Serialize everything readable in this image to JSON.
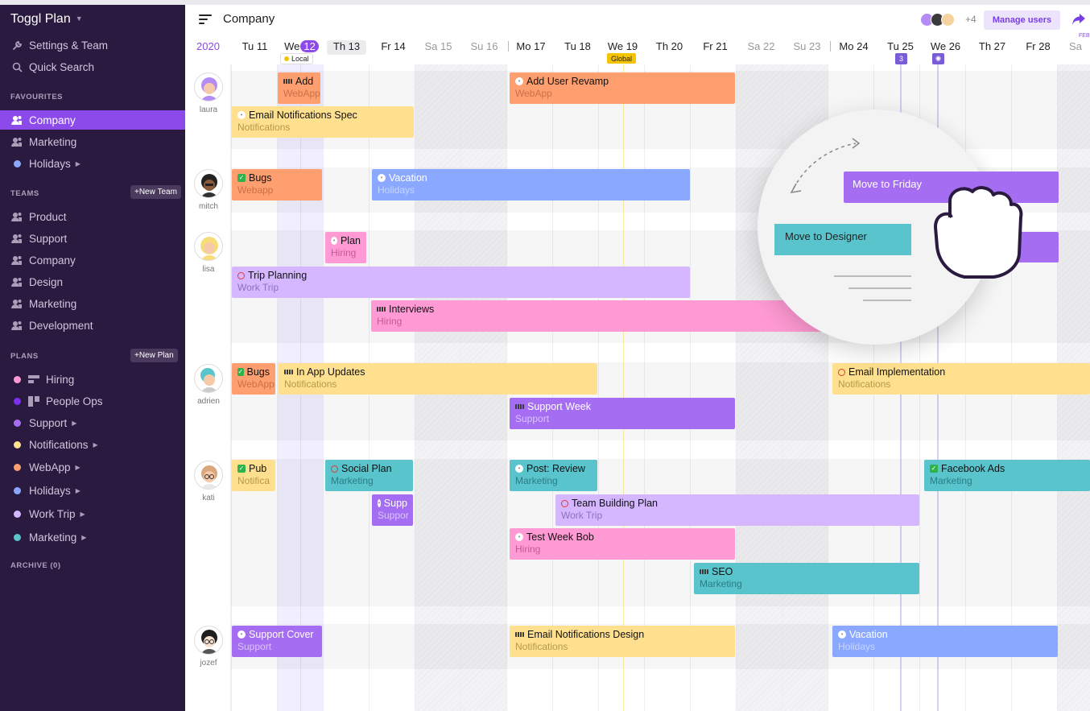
{
  "app": {
    "brand": "Toggl Plan",
    "settings_label": "Settings & Team",
    "search_label": "Quick Search"
  },
  "sidebar": {
    "favourites_title": "FAVOURITES",
    "favourites": [
      {
        "label": "Company",
        "active": true
      },
      {
        "label": "Marketing"
      },
      {
        "label": "Holidays",
        "dot": "#8aa8ff"
      }
    ],
    "teams_title": "TEAMS",
    "new_team_label": "+New Team",
    "teams": [
      "Product",
      "Support",
      "Company",
      "Design",
      "Marketing",
      "Development"
    ],
    "plans_title": "PLANS",
    "new_plan_label": "+New Plan",
    "plans": [
      {
        "label": "Hiring",
        "dot": "#ff9ad4"
      },
      {
        "label": "People Ops",
        "dot": "#7b2ff0"
      },
      {
        "label": "Support",
        "dot": "#a56ef2"
      },
      {
        "label": "Notifications",
        "dot": "#ffe08e"
      },
      {
        "label": "WebApp",
        "dot": "#ff9e6e"
      },
      {
        "label": "Holidays",
        "dot": "#8aa8ff"
      },
      {
        "label": "Work Trip",
        "dot": "#d4b7ff"
      },
      {
        "label": "Marketing",
        "dot": "#5ac4cc"
      }
    ],
    "archive_label": "ARCHIVE (0)"
  },
  "header": {
    "title": "Company",
    "extra_users": "+4",
    "manage_users_label": "Manage users"
  },
  "timeline": {
    "year": "2020",
    "today_prefix": "We",
    "today_number": "12",
    "days": [
      "Tu 11",
      "Th 13",
      "Fr 14",
      "Sa 15",
      "Su 16",
      "Mo 17",
      "Tu 18",
      "We 19",
      "Th 20",
      "Fr 21",
      "Sa 22",
      "Su 23",
      "Mo 24",
      "Tu 25",
      "We 26",
      "Th 27",
      "Fr 28",
      "Sa"
    ],
    "next_month": "FEB",
    "local_tag": "Local",
    "global_tag": "Global",
    "marker_count": "3"
  },
  "users": [
    "laura",
    "mitch",
    "lisa",
    "adrien",
    "kati",
    "jozef"
  ],
  "tasks": [
    {
      "title": "Add",
      "sub": "WebApp",
      "color": "orange",
      "icon": "prog"
    },
    {
      "title": "Add User Revamp",
      "sub": "WebApp",
      "color": "orange",
      "icon": "cmt"
    },
    {
      "title": "Email Notifications Spec",
      "sub": "Notifications",
      "color": "yellow",
      "icon": "cmt"
    },
    {
      "title": "Bugs",
      "sub": "Webapp",
      "color": "orange",
      "icon": "chk"
    },
    {
      "title": "Vacation",
      "sub": "Holidays",
      "color": "blue",
      "icon": "cmt"
    },
    {
      "title": "Plan",
      "sub": "Hiring",
      "color": "pink",
      "icon": "cmt"
    },
    {
      "title": "Trip Planning",
      "sub": "Work Trip",
      "color": "lilac",
      "icon": "blk"
    },
    {
      "title": "Interviews",
      "sub": "Hiring",
      "color": "pink",
      "icon": "prog"
    },
    {
      "title": "Bugs",
      "sub": "WebApp",
      "color": "orange",
      "icon": "chk"
    },
    {
      "title": "In App Updates",
      "sub": "Notifications",
      "color": "yellow",
      "icon": "prog"
    },
    {
      "title": "Email Implementation",
      "sub": "Notifications",
      "color": "yellow",
      "icon": "blk"
    },
    {
      "title": "Support Week",
      "sub": "Support",
      "color": "purple",
      "icon": "prog"
    },
    {
      "title": "Pub",
      "sub": "Notifica",
      "color": "yellow",
      "icon": "chk"
    },
    {
      "title": "Social Plan",
      "sub": "Marketing",
      "color": "teal",
      "icon": "blk"
    },
    {
      "title": "Post: Review",
      "sub": "Marketing",
      "color": "teal",
      "icon": "cmt"
    },
    {
      "title": "Facebook Ads",
      "sub": "Marketing",
      "color": "teal",
      "icon": "chk"
    },
    {
      "title": "Supp",
      "sub": "Suppor",
      "color": "purple",
      "icon": "cmt"
    },
    {
      "title": "Team Building Plan",
      "sub": "Work Trip",
      "color": "lilac",
      "icon": "blk"
    },
    {
      "title": "Test Week Bob",
      "sub": "Hiring",
      "color": "pink",
      "icon": "cmt"
    },
    {
      "title": "SEO",
      "sub": "Marketing",
      "color": "teal",
      "icon": "prog"
    },
    {
      "title": "Support Cover",
      "sub": "Support",
      "color": "purple",
      "icon": "cmt"
    },
    {
      "title": "Email Notifications Design",
      "sub": "Notifications",
      "color": "yellow",
      "icon": "prog"
    },
    {
      "title": "Vacation",
      "sub": "Holidays",
      "color": "blue",
      "icon": "cmt"
    }
  ],
  "zoom": {
    "move_friday": "Move to Friday",
    "move_designer": "Move to Designer"
  }
}
